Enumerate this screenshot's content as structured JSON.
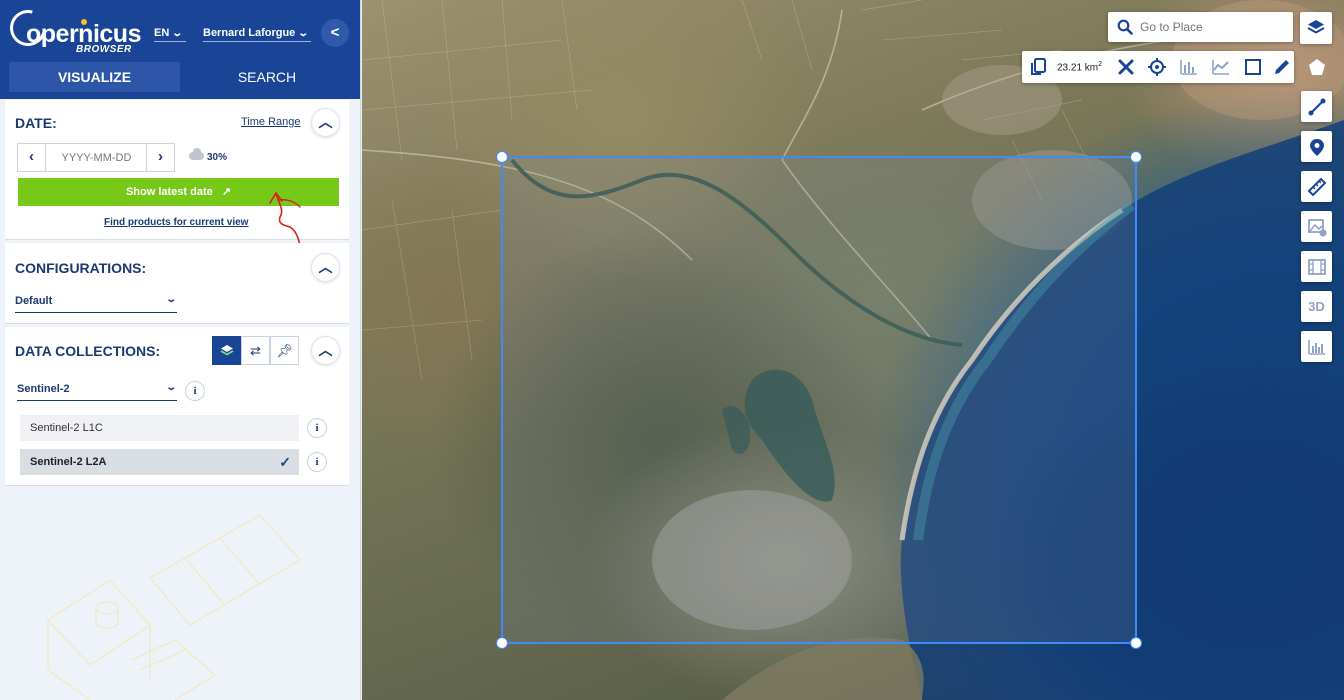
{
  "brand": {
    "logo_text": "opernicus",
    "logo_sub": "BROWSER"
  },
  "header": {
    "language": "EN",
    "user": "Bernard Laforgue"
  },
  "tabs": {
    "visualize": "VISUALIZE",
    "search": "SEARCH"
  },
  "date": {
    "title": "DATE:",
    "time_range": "Time Range",
    "placeholder": "YYYY-MM-DD",
    "cloud_cover": "30%",
    "latest_button": "Show latest date",
    "find_products": "Find products for current view"
  },
  "configurations": {
    "title": "CONFIGURATIONS:",
    "selected": "Default"
  },
  "data_collections": {
    "title": "DATA COLLECTIONS:",
    "selected": "Sentinel-2",
    "items": [
      {
        "label": "Sentinel-2 L1C",
        "selected": false
      },
      {
        "label": "Sentinel-2 L2A",
        "selected": true
      }
    ]
  },
  "map": {
    "search_placeholder": "Go to Place",
    "area_value": "23.21 km",
    "area_unit_sup": "2",
    "btn_3d": "3D",
    "icons": [
      "search-icon",
      "layers-icon",
      "copy-icon",
      "close-icon",
      "crosshair-icon",
      "bar-chart-icon",
      "line-chart-icon",
      "square-icon",
      "pencil-icon",
      "pentagon-icon",
      "line-icon",
      "pin-icon",
      "ruler-icon",
      "image-icon",
      "film-icon",
      "histogram-icon"
    ]
  },
  "colors": {
    "header": "#1a4597",
    "accent_green": "#77c919",
    "selection": "#3d8bfd"
  }
}
